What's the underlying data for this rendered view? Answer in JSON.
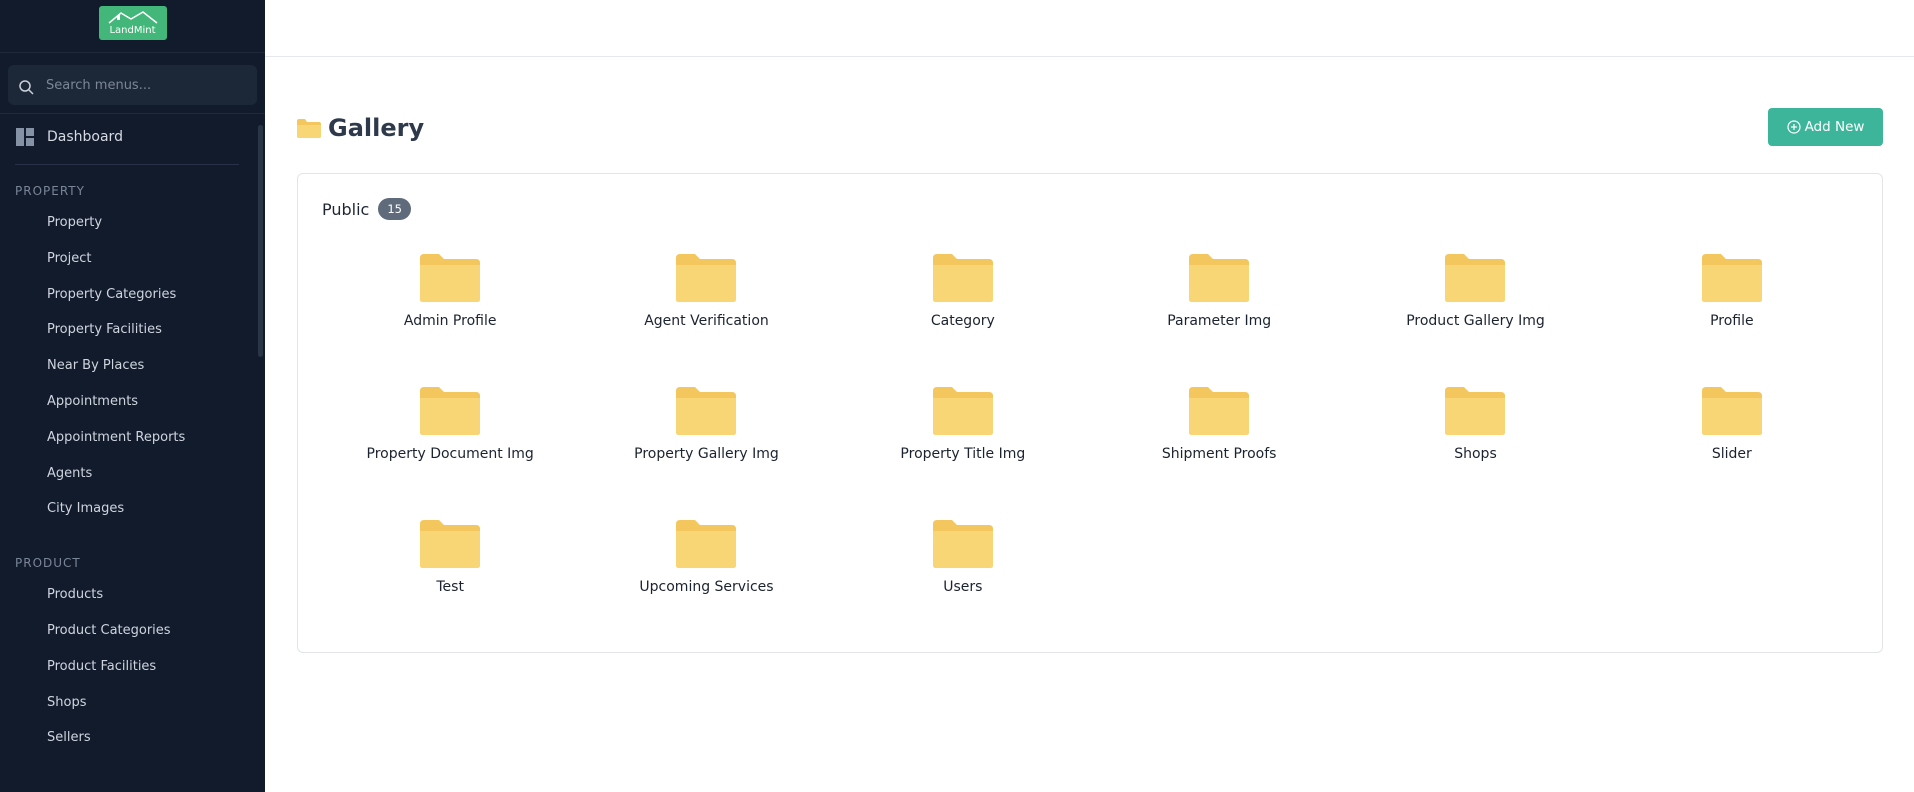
{
  "app": {
    "logo_text": "LandMint"
  },
  "sidebar": {
    "search_placeholder": "Search menus...",
    "dashboard_label": "Dashboard",
    "sections": [
      {
        "title": "PROPERTY",
        "items": [
          "Property",
          "Project",
          "Property Categories",
          "Property Facilities",
          "Near By Places",
          "Appointments",
          "Appointment Reports",
          "Agents",
          "City Images"
        ]
      },
      {
        "title": "PRODUCT",
        "items": [
          "Products",
          "Product Categories",
          "Product Facilities",
          "Shops",
          "Sellers"
        ]
      }
    ]
  },
  "page": {
    "title": "Gallery",
    "add_button_label": "Add New"
  },
  "gallery": {
    "section_title": "Public",
    "count": "15",
    "folders": [
      "Admin Profile",
      "Agent Verification",
      "Category",
      "Parameter Img",
      "Product Gallery Img",
      "Profile",
      "Property Document Img",
      "Property Gallery Img",
      "Property Title Img",
      "Shipment Proofs",
      "Shops",
      "Slider",
      "Test",
      "Upcoming Services",
      "Users"
    ]
  },
  "colors": {
    "sidebar_bg": "#111b2c",
    "accent": "#3cb59b",
    "logo_bg": "#43b77a",
    "folder": "#f8d676",
    "folder_tab": "#f3c75d"
  }
}
